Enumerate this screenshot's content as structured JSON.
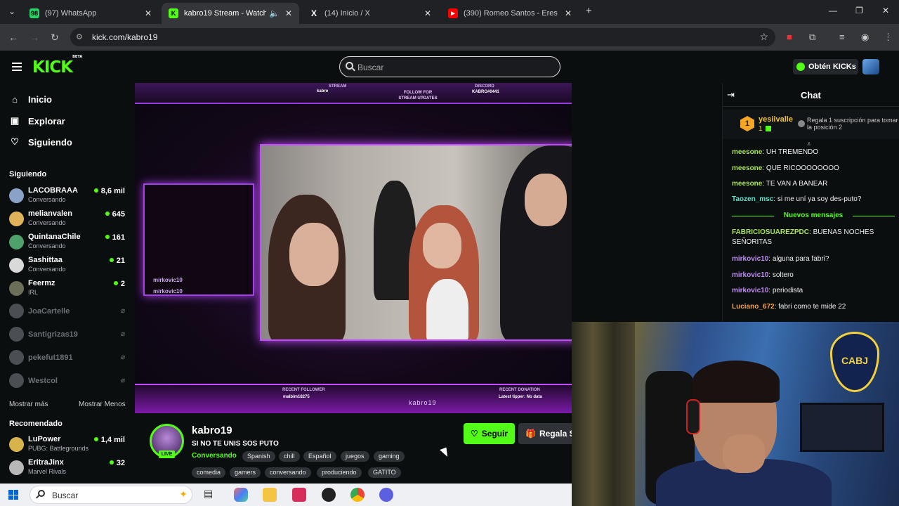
{
  "browser": {
    "tabs": [
      {
        "title": "(97) WhatsApp",
        "color": "#25d366",
        "glyph": "98"
      },
      {
        "title": "kabro19 Stream - Watch Live",
        "color": "#53fc18",
        "glyph": "K"
      },
      {
        "title": "(14) Inicio / X",
        "color": "#202124",
        "glyph": "X"
      },
      {
        "title": "(390) Romeo Santos - Eres Mía",
        "color": "#ff0000",
        "glyph": "▶"
      }
    ],
    "url": "kick.com/kabro19"
  },
  "header": {
    "logo": "KICK",
    "logo_badge": "BETA",
    "search_placeholder": "Buscar",
    "kicks_label": "Obtén KICKs"
  },
  "sidebar": {
    "nav": [
      {
        "label": "Inicio",
        "icon": "home-icon"
      },
      {
        "label": "Explorar",
        "icon": "compass-icon"
      },
      {
        "label": "Siguiendo",
        "icon": "heart-icon"
      }
    ],
    "following_header": "Siguiendo",
    "following": [
      {
        "name": "LACOBRAAA",
        "sub": "Conversando",
        "viewers": "8,6 mil",
        "color": "#8aa2c8"
      },
      {
        "name": "melianvalen",
        "sub": "Conversando",
        "viewers": "645",
        "color": "#e0b35a"
      },
      {
        "name": "QuintanaChile",
        "sub": "Conversando",
        "viewers": "161",
        "color": "#4fa16c"
      },
      {
        "name": "Sashittaa",
        "sub": "Conversando",
        "viewers": "21",
        "color": "#d9d9d9"
      },
      {
        "name": "Feermz",
        "sub": "IRL",
        "viewers": "2",
        "color": "#6b6e58"
      }
    ],
    "offline": [
      {
        "name": "JoaCartelle",
        "color": "#9aa0a6"
      },
      {
        "name": "Santigrizas19",
        "color": "#9aa0a6"
      },
      {
        "name": "pekefut1891",
        "color": "#9aa0a6"
      },
      {
        "name": "Westcol",
        "color": "#9aa0a6"
      }
    ],
    "show_more": "Mostrar más",
    "show_less": "Mostrar Menos",
    "recommended_header": "Recomendado",
    "recommended": [
      {
        "name": "LuPower",
        "sub": "PUBG: Battlegrounds",
        "viewers": "1,4 mil",
        "color": "#d8b34a"
      },
      {
        "name": "EritraJinx",
        "sub": "Marvel Rivals",
        "viewers": "32",
        "color": "#b8b8b8"
      }
    ]
  },
  "stream_overlay": {
    "top_labels": [
      "STREAM",
      "kabro",
      "FOLLOW FOR STREAM UPDATES",
      "DISCORD",
      "KABRO#0441"
    ],
    "bottom_left_label": "RECENT FOLLOWER",
    "bottom_left_value": "malbim18275",
    "bottom_right_label": "RECENT DONATION",
    "bottom_right_value": "Latest tipper: No data",
    "center_name": "kabro19",
    "overlay_chat": [
      "mirkovic10",
      "mirkovic10"
    ]
  },
  "channel": {
    "name": "kabro19",
    "live_badge": "LIVE",
    "title": "SI NO TE UNIS SOS PUTO",
    "category": "Conversando",
    "tags_row1": [
      "Spanish",
      "chill",
      "Español",
      "juegos",
      "gaming"
    ],
    "tags_row2": [
      "comedia",
      "gamers",
      "conversando",
      "produciendo",
      "GATITO"
    ],
    "follow_label": "Seguir",
    "gift_label": "Regala S"
  },
  "chat": {
    "title": "Chat",
    "pinned": {
      "rank": "1",
      "user": "yesiivalle",
      "count": "1",
      "text": "Regala 1 suscripción para tomar la posición 2"
    },
    "new_messages_label": "Nuevos mensajes",
    "messages_before": [
      {
        "user": "meesone",
        "text": "UH TREMENDO",
        "color": "#a8e05a"
      },
      {
        "user": "meesone",
        "text": "QUE RICOOOOOOOO",
        "color": "#a8e05a"
      },
      {
        "user": "meesone",
        "text": "TE VAN A BANEAR",
        "color": "#a8e05a"
      },
      {
        "user": "Taozen_msc",
        "text": "si me uní ya soy des-puto?",
        "color": "#5ee0c8"
      }
    ],
    "messages_after": [
      {
        "user": "FABRICIOSUAREZPDC",
        "text": "BUENAS NOCHES SEÑORITAS",
        "color": "#a8e05a"
      },
      {
        "user": "mirkovic10",
        "text": "alguna para fabri?",
        "color": "#c08cf0"
      },
      {
        "user": "mirkovic10",
        "text": "soltero",
        "color": "#c08cf0"
      },
      {
        "user": "mirkovic10",
        "text": "periodista",
        "color": "#c08cf0"
      },
      {
        "user": "Luciano_672",
        "text": "fabri como te mide 22",
        "color": "#f5a04a"
      }
    ]
  },
  "webcam": {
    "crest_text": "CABJ"
  },
  "taskbar": {
    "search_text": "Buscar"
  }
}
